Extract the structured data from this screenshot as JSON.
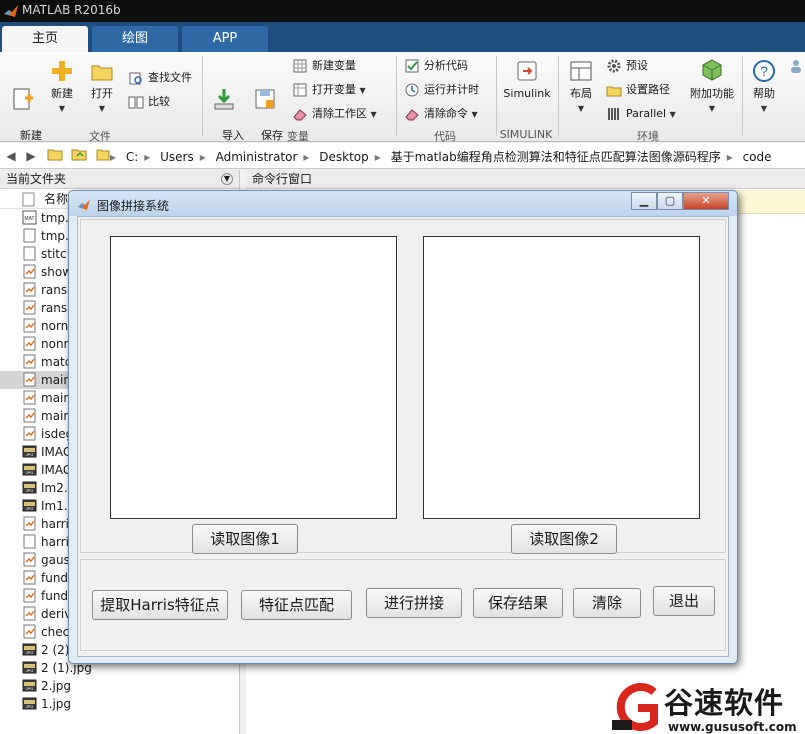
{
  "app": {
    "title": "MATLAB R2016b"
  },
  "tabs": [
    {
      "label": "主页"
    },
    {
      "label": "绘图"
    },
    {
      "label": "APP"
    }
  ],
  "ribbon": {
    "groups": {
      "file": "文件",
      "variable": "变量",
      "code": "代码",
      "simulink": "SIMULINK",
      "env": "环境"
    },
    "new_script": "新建\n脚本",
    "new": "新建",
    "open": "打开",
    "find_files": "查找文件",
    "compare": "比较",
    "import_data": "导入\n数据",
    "save_workspace": "保存\n工作区",
    "new_variable": "新建变量",
    "open_variable": "打开变量",
    "clear_workspace": "清除工作区",
    "analyze_code": "分析代码",
    "run_time": "运行并计时",
    "clear_commands": "清除命令",
    "simulink": "Simulink",
    "layout": "布局",
    "preferences": "预设",
    "set_path": "设置路径",
    "parallel": "Parallel",
    "addons": "附加功能",
    "help": "帮助"
  },
  "address": {
    "segments": [
      "C:",
      "Users",
      "Administrator",
      "Desktop",
      "基于matlab编程角点检测算法和特征点匹配算法图像源码程序",
      "code"
    ]
  },
  "left_panel": {
    "title": "当前文件夹",
    "column_name": "名称",
    "files": [
      {
        "name": "tmp.",
        "icon": "mat-file-icon"
      },
      {
        "name": "tmp.",
        "icon": "m-file-icon"
      },
      {
        "name": "stitc",
        "icon": "m-file-icon"
      },
      {
        "name": "show",
        "icon": "fig-file-icon"
      },
      {
        "name": "rans",
        "icon": "fig-file-icon"
      },
      {
        "name": "rans",
        "icon": "fig-file-icon"
      },
      {
        "name": "norn",
        "icon": "fig-file-icon"
      },
      {
        "name": "nonr",
        "icon": "fig-file-icon"
      },
      {
        "name": "matc",
        "icon": "fig-file-icon"
      },
      {
        "name": "main",
        "icon": "fig-file-icon",
        "selected": true
      },
      {
        "name": "main",
        "icon": "fig-file-icon"
      },
      {
        "name": "main",
        "icon": "fig-file-icon"
      },
      {
        "name": "isdeg",
        "icon": "fig-file-icon"
      },
      {
        "name": "IMAG",
        "icon": "jpg-file-icon"
      },
      {
        "name": "IMAG",
        "icon": "jpg-file-icon"
      },
      {
        "name": "Im2.",
        "icon": "jpg-file-icon"
      },
      {
        "name": "Im1.",
        "icon": "jpg-file-icon"
      },
      {
        "name": "harri",
        "icon": "fig-file-icon"
      },
      {
        "name": "harri",
        "icon": "m-file-icon"
      },
      {
        "name": "gaus",
        "icon": "fig-file-icon"
      },
      {
        "name": "fund",
        "icon": "fig-file-icon"
      },
      {
        "name": "fund",
        "icon": "fig-file-icon"
      },
      {
        "name": "deriv",
        "icon": "fig-file-icon"
      },
      {
        "name": "chec",
        "icon": "fig-file-icon"
      },
      {
        "name": "2 (2)",
        "icon": "jpg-file-icon"
      },
      {
        "name": "2 (1).jpg",
        "icon": "jpg-file-icon"
      },
      {
        "name": "2.jpg",
        "icon": "jpg-file-icon"
      },
      {
        "name": "1.jpg",
        "icon": "jpg-file-icon"
      }
    ]
  },
  "command_window": {
    "title": "命令行窗口"
  },
  "dialog": {
    "title": "图像拼接系统",
    "read_image1": "读取图像1",
    "read_image2": "读取图像2",
    "extract_harris": "提取Harris特征点",
    "match_points": "特征点匹配",
    "stitch": "进行拼接",
    "save_result": "保存结果",
    "clear": "清除",
    "exit": "退出"
  },
  "watermark": {
    "name": "谷速软件",
    "url": "www.gususoft.com"
  }
}
